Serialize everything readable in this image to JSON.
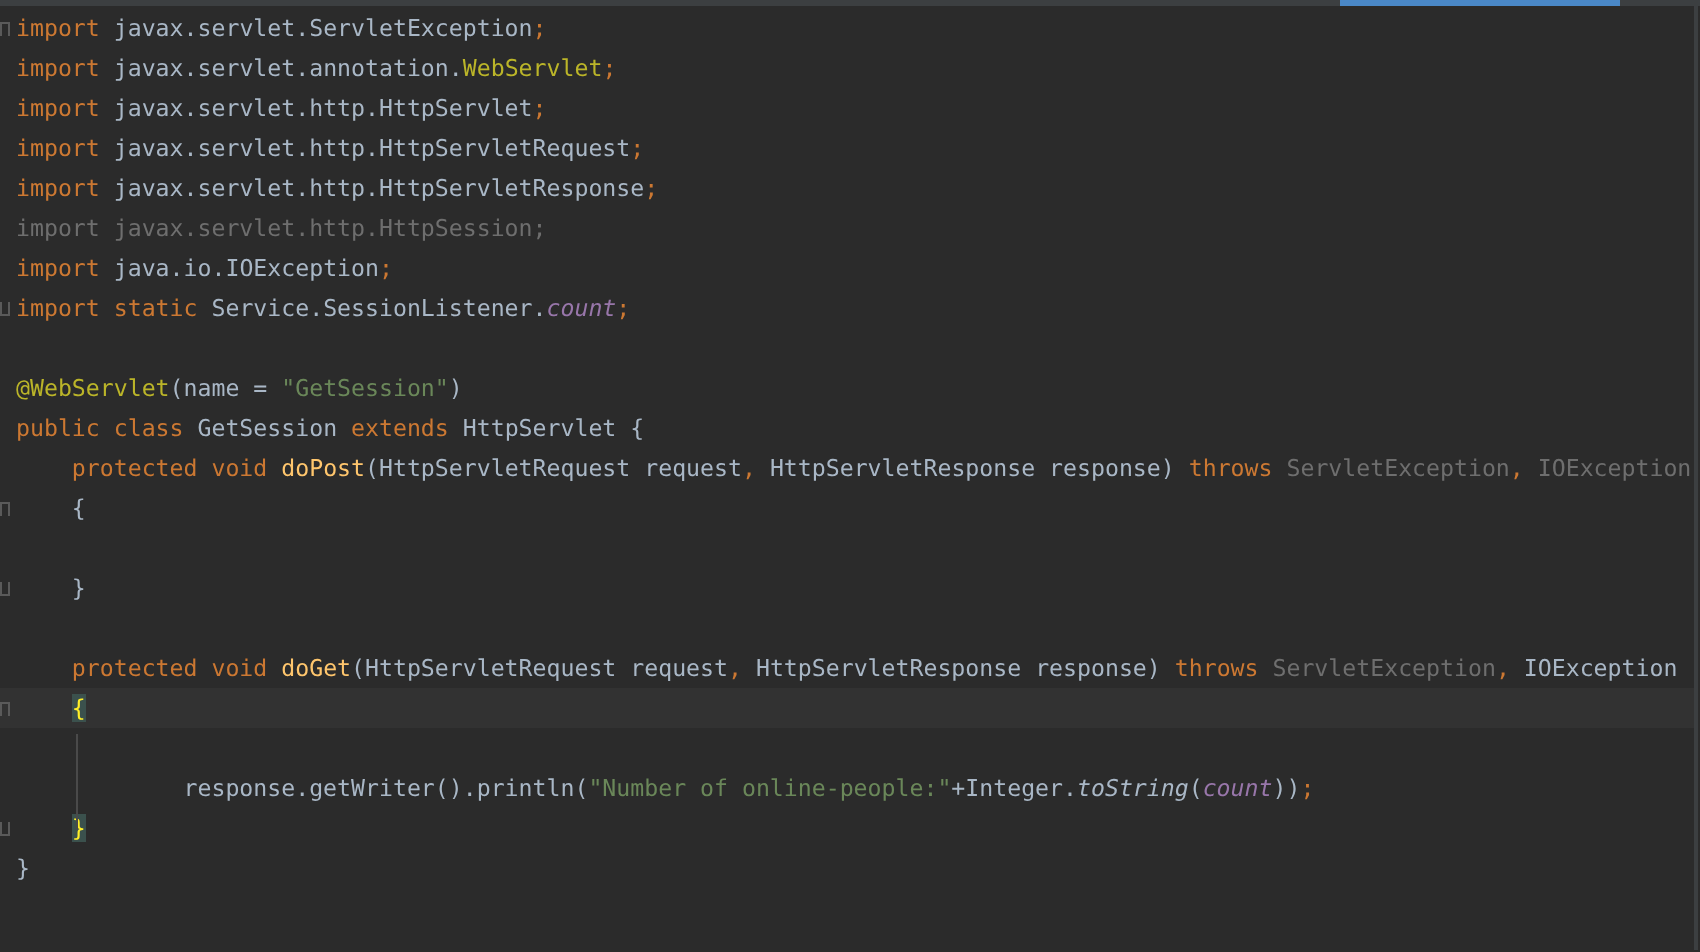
{
  "editor": {
    "lines": [
      {
        "kind": "code",
        "fold_start": true,
        "tokens": [
          {
            "text": "import",
            "kind": "keyword"
          },
          {
            "text": " javax.servlet.ServletException",
            "kind": "plain"
          },
          {
            "text": ";",
            "kind": "punct"
          }
        ]
      },
      {
        "kind": "code",
        "tokens": [
          {
            "text": "import",
            "kind": "keyword"
          },
          {
            "text": " javax.servlet.annotation.",
            "kind": "plain"
          },
          {
            "text": "WebServlet",
            "kind": "annotation"
          },
          {
            "text": ";",
            "kind": "punct"
          }
        ]
      },
      {
        "kind": "code",
        "tokens": [
          {
            "text": "import",
            "kind": "keyword"
          },
          {
            "text": " javax.servlet.http.HttpServlet",
            "kind": "plain"
          },
          {
            "text": ";",
            "kind": "punct"
          }
        ]
      },
      {
        "kind": "code",
        "tokens": [
          {
            "text": "import",
            "kind": "keyword"
          },
          {
            "text": " javax.servlet.http.HttpServletRequest",
            "kind": "plain"
          },
          {
            "text": ";",
            "kind": "punct"
          }
        ]
      },
      {
        "kind": "code",
        "tokens": [
          {
            "text": "import",
            "kind": "keyword"
          },
          {
            "text": " javax.servlet.http.HttpServletResponse",
            "kind": "plain"
          },
          {
            "text": ";",
            "kind": "punct"
          }
        ]
      },
      {
        "kind": "code",
        "tokens": [
          {
            "text": "import javax.servlet.http.HttpSession;",
            "kind": "unused"
          }
        ]
      },
      {
        "kind": "code",
        "tokens": [
          {
            "text": "import",
            "kind": "keyword"
          },
          {
            "text": " java.io.IOException",
            "kind": "plain"
          },
          {
            "text": ";",
            "kind": "punct"
          }
        ]
      },
      {
        "kind": "code",
        "fold_end": true,
        "tokens": [
          {
            "text": "import static",
            "kind": "keyword"
          },
          {
            "text": " Service.SessionListener.",
            "kind": "plain"
          },
          {
            "text": "count",
            "kind": "field"
          },
          {
            "text": ";",
            "kind": "punct"
          }
        ]
      },
      {
        "kind": "blank"
      },
      {
        "kind": "code",
        "tokens": [
          {
            "text": "@WebServlet",
            "kind": "annotation"
          },
          {
            "text": "(name = ",
            "kind": "plain"
          },
          {
            "text": "\"GetSession\"",
            "kind": "string"
          },
          {
            "text": ")",
            "kind": "plain"
          }
        ]
      },
      {
        "kind": "code",
        "tokens": [
          {
            "text": "public class",
            "kind": "keyword"
          },
          {
            "text": " GetSession ",
            "kind": "plain"
          },
          {
            "text": "extends",
            "kind": "keyword"
          },
          {
            "text": " HttpServlet {",
            "kind": "plain"
          }
        ]
      },
      {
        "kind": "code",
        "tokens": [
          {
            "text": "    protected void ",
            "kind": "keyword"
          },
          {
            "text": "doPost",
            "kind": "method"
          },
          {
            "text": "(HttpServletRequest request",
            "kind": "plain"
          },
          {
            "text": ",",
            "kind": "punct"
          },
          {
            "text": " HttpServletResponse response) ",
            "kind": "plain"
          },
          {
            "text": "throws",
            "kind": "keyword"
          },
          {
            "text": " ServletException",
            "kind": "unused"
          },
          {
            "text": ",",
            "kind": "punct"
          },
          {
            "text": " IOException",
            "kind": "unused"
          }
        ]
      },
      {
        "kind": "code",
        "fold_start": true,
        "tokens": [
          {
            "text": "    {",
            "kind": "plain"
          }
        ]
      },
      {
        "kind": "blank"
      },
      {
        "kind": "code",
        "fold_end": true,
        "tokens": [
          {
            "text": "    }",
            "kind": "plain"
          }
        ]
      },
      {
        "kind": "blank"
      },
      {
        "kind": "code",
        "tokens": [
          {
            "text": "    protected void ",
            "kind": "keyword"
          },
          {
            "text": "doGet",
            "kind": "method"
          },
          {
            "text": "(HttpServletRequest request",
            "kind": "plain"
          },
          {
            "text": ",",
            "kind": "punct"
          },
          {
            "text": " HttpServletResponse response) ",
            "kind": "plain"
          },
          {
            "text": "throws",
            "kind": "keyword"
          },
          {
            "text": " ServletException",
            "kind": "unused"
          },
          {
            "text": ",",
            "kind": "punct"
          },
          {
            "text": " IOException",
            "kind": "plain"
          }
        ]
      },
      {
        "kind": "code",
        "fold_start": true,
        "current": true,
        "tokens": [
          {
            "text": "    {",
            "kind": "brace"
          }
        ]
      },
      {
        "kind": "blank"
      },
      {
        "kind": "code",
        "tokens": [
          {
            "text": "            response.getWriter().println(",
            "kind": "plain"
          },
          {
            "text": "\"Number of online-people:\"",
            "kind": "string"
          },
          {
            "text": "+Integer.",
            "kind": "plain"
          },
          {
            "text": "toString",
            "kind": "static"
          },
          {
            "text": "(",
            "kind": "plain"
          },
          {
            "text": "count",
            "kind": "field"
          },
          {
            "text": "))",
            "kind": "plain"
          },
          {
            "text": ";",
            "kind": "punct"
          }
        ]
      },
      {
        "kind": "code",
        "fold_end": true,
        "tokens": [
          {
            "text": "    }",
            "kind": "brace"
          }
        ]
      },
      {
        "kind": "code",
        "tokens": [
          {
            "text": "}",
            "kind": "plain"
          }
        ]
      }
    ]
  }
}
